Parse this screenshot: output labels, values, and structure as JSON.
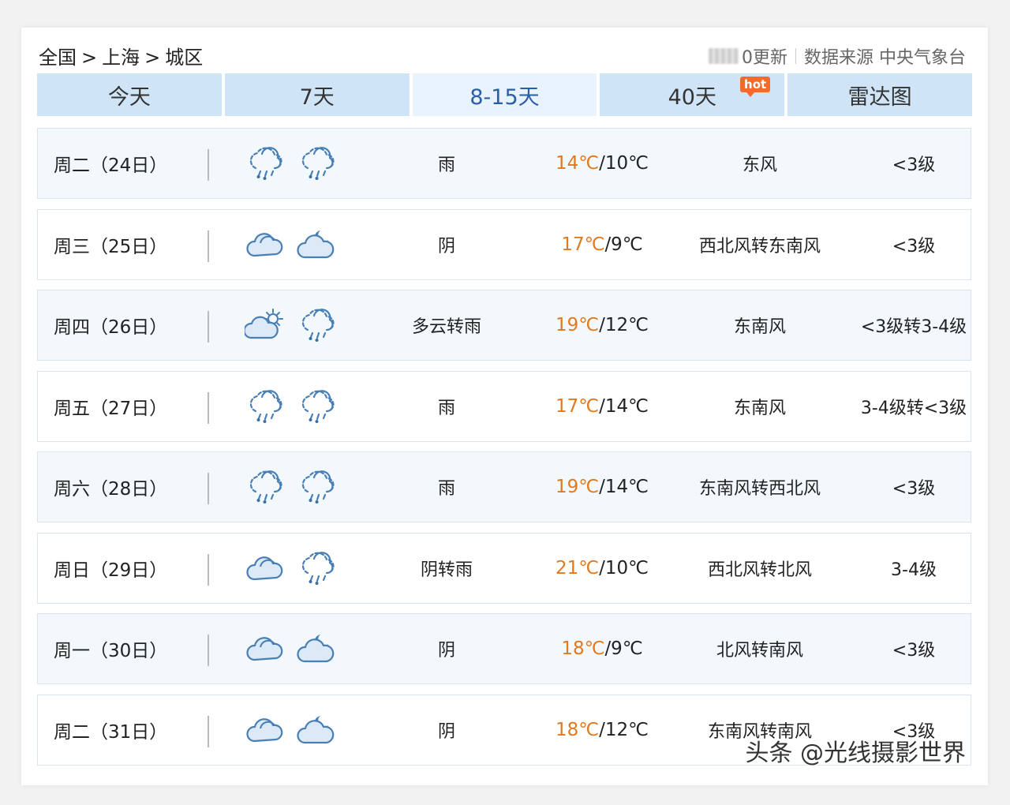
{
  "breadcrumb": {
    "country": "全国",
    "city": "上海",
    "district": "城区",
    "sep": ">"
  },
  "header": {
    "update_text": "0更新",
    "source_text": "数据来源 中央气象台"
  },
  "tabs": [
    {
      "label": "今天"
    },
    {
      "label": "7天"
    },
    {
      "label": "8-15天"
    },
    {
      "label": "40天",
      "badge": "hot"
    },
    {
      "label": "雷达图"
    }
  ],
  "active_tab": "8-15天",
  "colors": {
    "high_temp": "#e07a1f",
    "tab_bg": "#cfe4f7",
    "active_tab_text": "#2a5fa8",
    "hot_badge": "#f26b2a"
  },
  "forecast": [
    {
      "date": "周二（24日）",
      "icon_day": "rain-icon",
      "icon_night": "rain-icon",
      "desc": "雨",
      "high": "14℃",
      "low": "/10℃",
      "wind": "东风",
      "level": "<3级"
    },
    {
      "date": "周三（25日）",
      "icon_day": "cloudy-icon",
      "icon_night": "cloudy-night-icon",
      "desc": "阴",
      "high": "17℃",
      "low": "/9℃",
      "wind": "西北风转东南风",
      "level": "<3级"
    },
    {
      "date": "周四（26日）",
      "icon_day": "partly-cloudy-icon",
      "icon_night": "rain-icon",
      "desc": "多云转雨",
      "high": "19℃",
      "low": "/12℃",
      "wind": "东南风",
      "level": "<3级转3-4级"
    },
    {
      "date": "周五（27日）",
      "icon_day": "rain-icon",
      "icon_night": "rain-icon",
      "desc": "雨",
      "high": "17℃",
      "low": "/14℃",
      "wind": "东南风",
      "level": "3-4级转<3级"
    },
    {
      "date": "周六（28日）",
      "icon_day": "rain-icon",
      "icon_night": "rain-icon",
      "desc": "雨",
      "high": "19℃",
      "low": "/14℃",
      "wind": "东南风转西北风",
      "level": "<3级"
    },
    {
      "date": "周日（29日）",
      "icon_day": "cloudy-icon",
      "icon_night": "rain-icon",
      "desc": "阴转雨",
      "high": "21℃",
      "low": "/10℃",
      "wind": "西北风转北风",
      "level": "3-4级"
    },
    {
      "date": "周一（30日）",
      "icon_day": "cloudy-icon",
      "icon_night": "cloudy-night-icon",
      "desc": "阴",
      "high": "18℃",
      "low": "/9℃",
      "wind": "北风转南风",
      "level": "<3级"
    },
    {
      "date": "周二（31日）",
      "icon_day": "cloudy-icon",
      "icon_night": "cloudy-night-icon",
      "desc": "阴",
      "high": "18℃",
      "low": "/12℃",
      "wind": "东南风转南风",
      "level": "<3级"
    }
  ],
  "watermark": "头条 @光线摄影世界"
}
